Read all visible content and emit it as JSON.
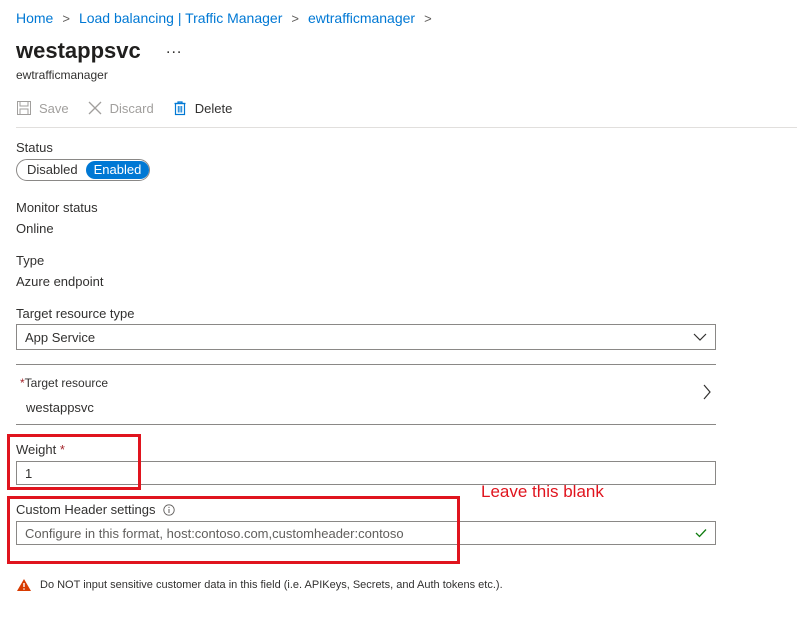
{
  "breadcrumb": {
    "items": [
      "Home",
      "Load balancing | Traffic Manager",
      "ewtrafficmanager"
    ],
    "separator": ">"
  },
  "header": {
    "title": "westappsvc",
    "more_label": "...",
    "subtitle": "ewtrafficmanager"
  },
  "toolbar": {
    "save_label": "Save",
    "discard_label": "Discard",
    "delete_label": "Delete"
  },
  "form": {
    "status": {
      "label": "Status",
      "options": [
        "Disabled",
        "Enabled"
      ],
      "selected": "Enabled"
    },
    "monitor_status": {
      "label": "Monitor status",
      "value": "Online"
    },
    "type": {
      "label": "Type",
      "value": "Azure endpoint"
    },
    "target_resource_type": {
      "label": "Target resource type",
      "value": "App Service"
    },
    "target_resource": {
      "required_mark": "*",
      "label": "Target resource",
      "value": "westappsvc"
    },
    "weight": {
      "label": "Weight",
      "required_mark": "*",
      "value": "1"
    },
    "custom_header": {
      "label": "Custom Header settings",
      "placeholder": "Configure in this format, host:contoso.com,customheader:contoso"
    }
  },
  "annotation": {
    "text": "Leave this blank",
    "color": "#e0141e"
  },
  "warning": {
    "text": "Do NOT input sensitive customer data in this field (i.e. APIKeys, Secrets, and Auth tokens etc.).",
    "icon": "warning-icon"
  },
  "colors": {
    "accent": "#0078d4",
    "required": "#a4262c",
    "valid_check": "#107c10",
    "warning_icon": "#d83b01"
  }
}
